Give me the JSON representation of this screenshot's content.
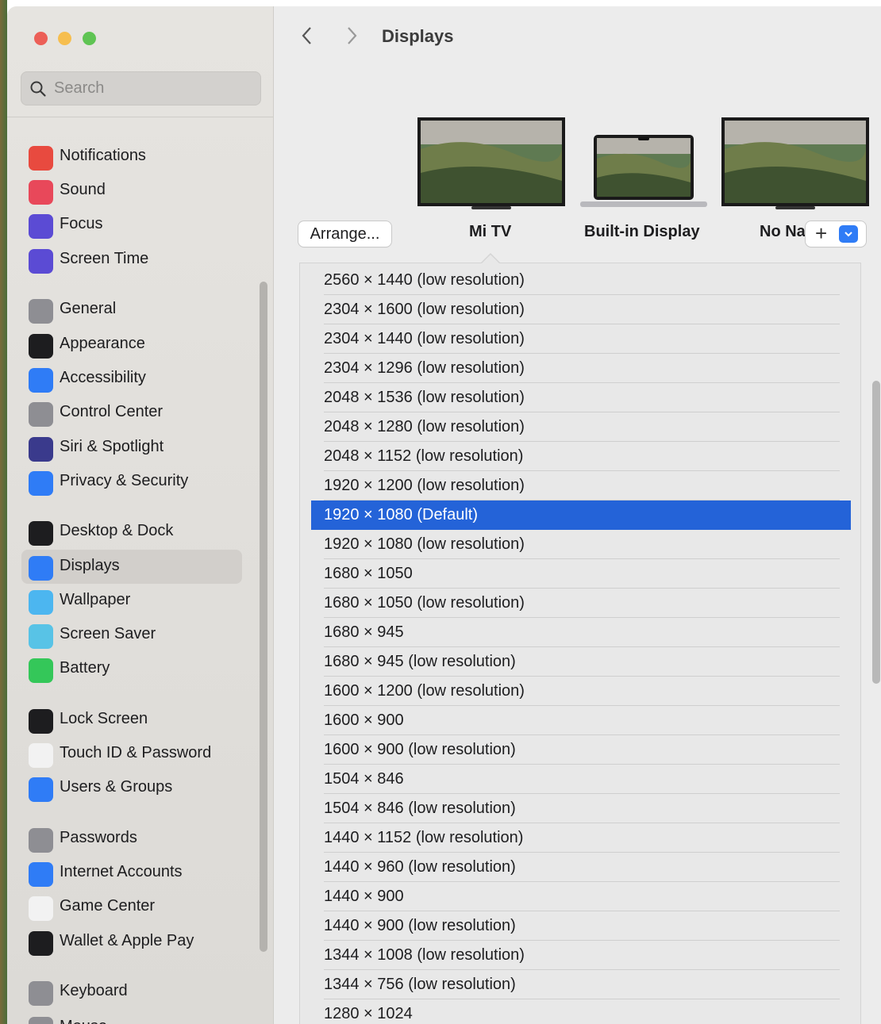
{
  "window": {
    "title": "Displays"
  },
  "search": {
    "placeholder": "Search"
  },
  "sidebar": {
    "items": [
      {
        "label": "Notifications",
        "icon": "bell-icon",
        "color": "#e84a3f"
      },
      {
        "label": "Sound",
        "icon": "speaker-icon",
        "color": "#e8485a"
      },
      {
        "label": "Focus",
        "icon": "moon-icon",
        "color": "#5b4bd4"
      },
      {
        "label": "Screen Time",
        "icon": "hourglass-icon",
        "color": "#5b4bd4"
      },
      {
        "label": "General",
        "icon": "gear-icon",
        "color": "#8e8e93"
      },
      {
        "label": "Appearance",
        "icon": "appearance-icon",
        "color": "#1d1d1f"
      },
      {
        "label": "Accessibility",
        "icon": "accessibility-icon",
        "color": "#2f7cf6"
      },
      {
        "label": "Control Center",
        "icon": "toggles-icon",
        "color": "#8e8e93"
      },
      {
        "label": "Siri & Spotlight",
        "icon": "siri-icon",
        "color": "#3a3a8c"
      },
      {
        "label": "Privacy & Security",
        "icon": "hand-icon",
        "color": "#2f7cf6"
      },
      {
        "label": "Desktop & Dock",
        "icon": "dock-icon",
        "color": "#1d1d1f"
      },
      {
        "label": "Displays",
        "icon": "sun-icon",
        "color": "#2f7cf6"
      },
      {
        "label": "Wallpaper",
        "icon": "flower-icon",
        "color": "#4cb6f0"
      },
      {
        "label": "Screen Saver",
        "icon": "screensaver-icon",
        "color": "#58c3e6"
      },
      {
        "label": "Battery",
        "icon": "battery-icon",
        "color": "#34c759"
      },
      {
        "label": "Lock Screen",
        "icon": "lock-icon",
        "color": "#1d1d1f"
      },
      {
        "label": "Touch ID & Password",
        "icon": "fingerprint-icon",
        "color": "#f2f2f2"
      },
      {
        "label": "Users & Groups",
        "icon": "users-icon",
        "color": "#2f7cf6"
      },
      {
        "label": "Passwords",
        "icon": "key-icon",
        "color": "#8e8e93"
      },
      {
        "label": "Internet Accounts",
        "icon": "at-icon",
        "color": "#2f7cf6"
      },
      {
        "label": "Game Center",
        "icon": "game-center-icon",
        "color": "#f2f2f2"
      },
      {
        "label": "Wallet & Apple Pay",
        "icon": "wallet-icon",
        "color": "#1d1d1f"
      },
      {
        "label": "Keyboard",
        "icon": "keyboard-icon",
        "color": "#8e8e93"
      },
      {
        "label": "Mouse",
        "icon": "mouse-icon",
        "color": "#8e8e93"
      }
    ]
  },
  "toolbar": {
    "arrange_label": "Arrange...",
    "add_label": "+"
  },
  "displays": [
    {
      "label": "Mi TV"
    },
    {
      "label": "Built-in Display"
    },
    {
      "label": "No Na"
    }
  ],
  "resolutions": [
    "2560 × 1440 (low resolution)",
    "2304 × 1600 (low resolution)",
    "2304 × 1440 (low resolution)",
    "2304 × 1296 (low resolution)",
    "2048 × 1536 (low resolution)",
    "2048 × 1280 (low resolution)",
    "2048 × 1152 (low resolution)",
    "1920 × 1200 (low resolution)",
    "1920 × 1080 (Default)",
    "1920 × 1080 (low resolution)",
    "1680 × 1050",
    "1680 × 1050 (low resolution)",
    "1680 × 945",
    "1680 × 945 (low resolution)",
    "1600 × 1200 (low resolution)",
    "1600 × 900",
    "1600 × 900 (low resolution)",
    "1504 × 846",
    "1504 × 846 (low resolution)",
    "1440 × 1152 (low resolution)",
    "1440 × 960 (low resolution)",
    "1440 × 900",
    "1440 × 900 (low resolution)",
    "1344 × 1008 (low resolution)",
    "1344 × 756 (low resolution)",
    "1280 × 1024"
  ],
  "selected_resolution": "1920 × 1080 (Default)",
  "colors": {
    "accent": "#2463d8"
  }
}
